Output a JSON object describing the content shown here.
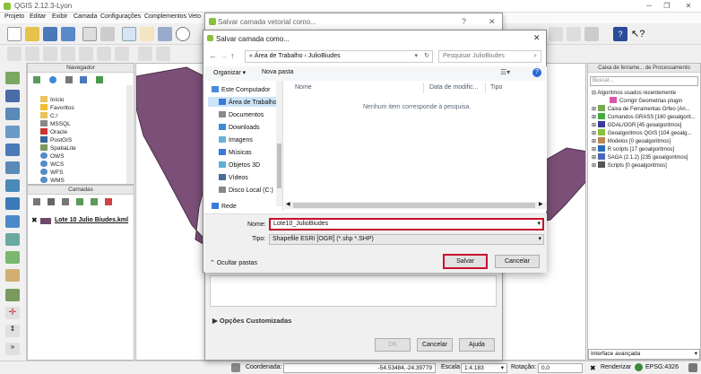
{
  "app": {
    "title": "QGIS 2.12.3-Lyon"
  },
  "menu": [
    "Projeto",
    "Editar",
    "Exibir",
    "Camada",
    "Configurações",
    "Complementos",
    "Veto"
  ],
  "navegador": {
    "title": "Navegador",
    "items": [
      "Início",
      "Favoritos",
      "C:/",
      "MSSQL",
      "Oracle",
      "PostGIS",
      "SpatiaLite",
      "OWS",
      "WCS",
      "WFS",
      "WMS"
    ]
  },
  "camadas": {
    "title": "Camadas",
    "layer": "Lote 10 Julio Biudes.kml"
  },
  "processing": {
    "title": "Caixa de ferrame... de Processamento",
    "search_placeholder": "Buscar...",
    "items": [
      "Algoritmos usados recentemente",
      "Corrigir Geometrias plugin",
      "Caixa de Ferramentas Orfeo (An...",
      "Comandos GRASS [160 geoalgorit...",
      "GDAL/OGR [45 geoalgoritmos]",
      "Geoalgoritmos QGIS [104 geoalg...",
      "Modelos [0 geoalgoritmos]",
      "R scripts [17 geoalgoritmos]",
      "SAGA (2.1.2) [235 geoalgoritmos]",
      "Scripts [0 geoalgoritmos]"
    ],
    "mode": "Interface avançada"
  },
  "status": {
    "coord_label": "Coordenada:",
    "coord_value": "-54.53484,-24.39779",
    "scale_label": "Escala",
    "scale_value": "1:4.183",
    "rotation_label": "Rotação:",
    "rotation_value": "0,0",
    "render_label": "Renderizar",
    "epsg": "EPSG:4326"
  },
  "back_dialog": {
    "title": "Salvar camada vetorial como...",
    "help": "?",
    "options_label": "Opções Customizadas",
    "ok": "OK",
    "cancel": "Cancelar",
    "help_btn": "Ajuda"
  },
  "dialog": {
    "title": "Salvar camada como...",
    "breadcrumb_sep": "«",
    "path": [
      "Área de Trabalho",
      "JulioBiudes"
    ],
    "search_placeholder": "Pesquisar JulioBiudes",
    "organize": "Organizar ▾",
    "new_folder": "Nova pasta",
    "tree": [
      "Este Computador",
      "Área de Trabalho",
      "Documentos",
      "Downloads",
      "Imagens",
      "Músicas",
      "Objetos 3D",
      "Vídeos",
      "Disco Local (C:)",
      "Rede"
    ],
    "columns": [
      "Nome",
      "Data de modific...",
      "Tipo"
    ],
    "empty_msg": "Nenhum item corresponde à pesquisa.",
    "name_label": "Nome:",
    "name_value": "Lote10_JulioBiudes",
    "type_label": "Tipo:",
    "type_value": "Shapefile ESRI [OGR] (*.shp *.SHP)",
    "hide_folders": "Ocultar pastas",
    "save": "Salvar",
    "cancel": "Cancelar"
  }
}
